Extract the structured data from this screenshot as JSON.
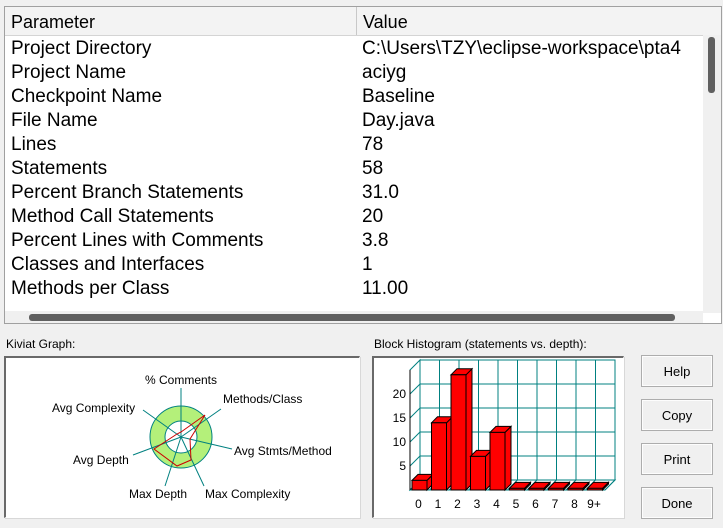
{
  "table": {
    "headers": {
      "parameter": "Parameter",
      "value": "Value"
    },
    "rows": [
      {
        "parameter": "Project Directory",
        "value": "C:\\Users\\TZY\\eclipse-workspace\\pta4"
      },
      {
        "parameter": "Project Name",
        "value": "aciyg"
      },
      {
        "parameter": "Checkpoint Name",
        "value": "Baseline"
      },
      {
        "parameter": "File Name",
        "value": "Day.java"
      },
      {
        "parameter": "Lines",
        "value": "78"
      },
      {
        "parameter": "Statements",
        "value": "58"
      },
      {
        "parameter": "Percent Branch Statements",
        "value": "31.0"
      },
      {
        "parameter": "Method Call Statements",
        "value": "20"
      },
      {
        "parameter": "Percent Lines with Comments",
        "value": "3.8"
      },
      {
        "parameter": "Classes and Interfaces",
        "value": "1"
      },
      {
        "parameter": "Methods per Class",
        "value": "11.00"
      }
    ]
  },
  "kiviat": {
    "label": "Kiviat Graph:",
    "axes": [
      "% Comments",
      "Methods/Class",
      "Avg Stmts/Method",
      "Max Complexity",
      "Max Depth",
      "Avg Depth",
      "Avg Complexity"
    ],
    "colors": {
      "ring": "#b4f07a",
      "spoke": "#008080",
      "polygon": "#cc0000"
    }
  },
  "histogram": {
    "label": "Block Histogram (statements vs. depth):",
    "bar_color": "#ff0000",
    "grid_color": "#008080"
  },
  "chart_data": {
    "type": "bar",
    "title": "Block Histogram (statements vs. depth):",
    "categories": [
      "0",
      "1",
      "2",
      "3",
      "4",
      "5",
      "6",
      "7",
      "8",
      "9+"
    ],
    "values": [
      2,
      14,
      24,
      7,
      12,
      0,
      0,
      0,
      0,
      0
    ],
    "yticks": [
      0,
      5,
      10,
      15,
      20
    ],
    "ylim": [
      0,
      25
    ],
    "grid": true
  },
  "buttons": {
    "help": "Help",
    "copy": "Copy",
    "print": "Print",
    "done": "Done"
  }
}
